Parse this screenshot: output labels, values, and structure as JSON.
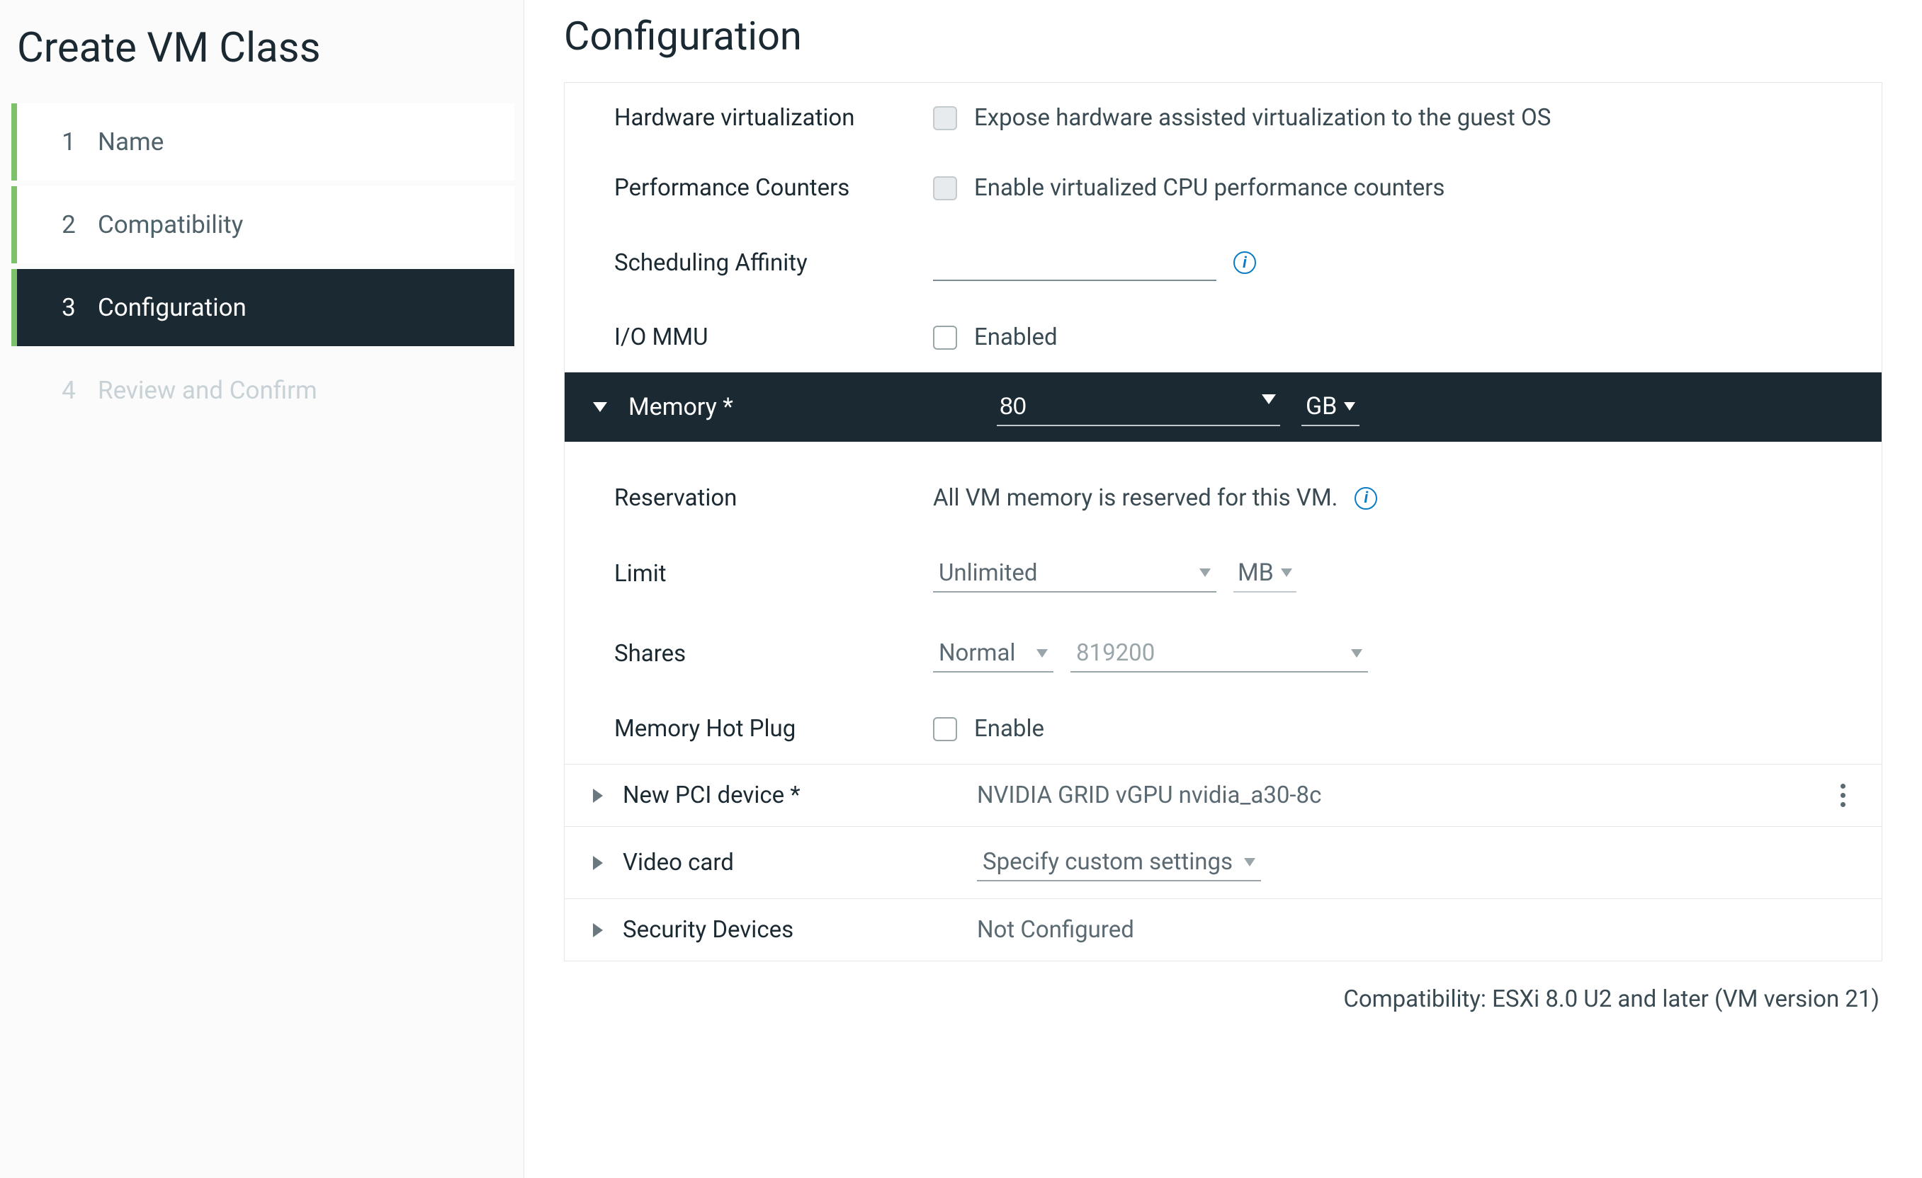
{
  "sidebar": {
    "title": "Create VM Class",
    "steps": [
      {
        "num": "1",
        "label": "Name"
      },
      {
        "num": "2",
        "label": "Compatibility"
      },
      {
        "num": "3",
        "label": "Configuration"
      },
      {
        "num": "4",
        "label": "Review and Confirm"
      }
    ]
  },
  "page": {
    "title": "Configuration"
  },
  "cpuadv": {
    "hwvirt_label": "Hardware virtualization",
    "hwvirt_check": "Expose hardware assisted virtualization to the guest OS",
    "perfcnt_label": "Performance Counters",
    "perfcnt_check": "Enable virtualized CPU performance counters",
    "affinity_label": "Scheduling Affinity",
    "affinity_value": "",
    "iommu_label": "I/O MMU",
    "iommu_check": "Enabled"
  },
  "memory": {
    "section": "Memory *",
    "value": "80",
    "unit": "GB",
    "reservation_label": "Reservation",
    "reservation_text": "All VM memory is reserved for this VM.",
    "limit_label": "Limit",
    "limit_value": "Unlimited",
    "limit_unit": "MB",
    "shares_label": "Shares",
    "shares_mode": "Normal",
    "shares_value": "819200",
    "hotplug_label": "Memory Hot Plug",
    "hotplug_check": "Enable"
  },
  "pci": {
    "label": "New PCI device *",
    "value": "NVIDIA GRID vGPU nvidia_a30-8c"
  },
  "video": {
    "label": "Video card",
    "value": "Specify custom settings"
  },
  "security": {
    "label": "Security Devices",
    "value": "Not Configured"
  },
  "footer": {
    "compat": "Compatibility: ESXi 8.0 U2 and later (VM version 21)"
  }
}
